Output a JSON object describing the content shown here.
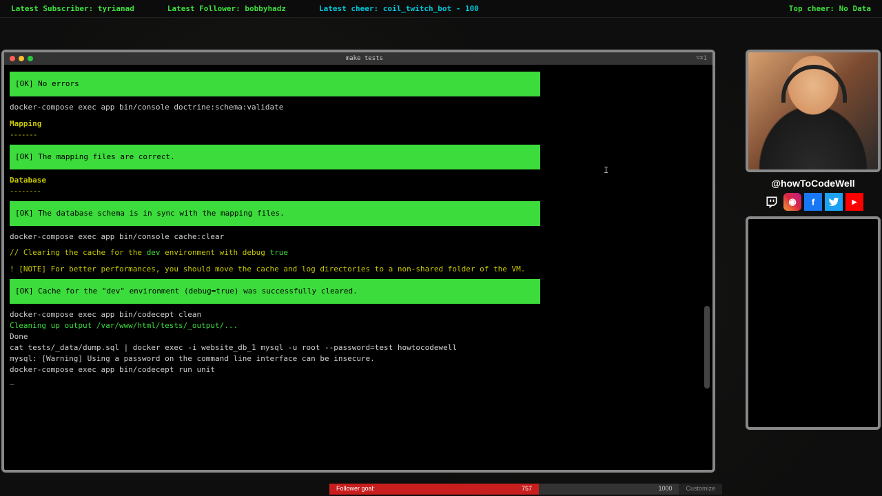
{
  "ticker": {
    "subscriber": {
      "label": "Latest Subscriber:",
      "value": "tyrianad"
    },
    "follower": {
      "label": "Latest Follower:",
      "value": "bobbyhadz"
    },
    "cheer": {
      "label": "Latest cheer:",
      "value": "coil_twitch_bot - 100"
    },
    "topcheer": {
      "label": "Top cheer:",
      "value": "No Data"
    }
  },
  "terminal": {
    "window_title": "make tests",
    "shortcut_hint": "⌥⌘1",
    "ok1": "[OK] No errors",
    "cmd1": "docker-compose exec app bin/console doctrine:schema:validate",
    "sec1": "Mapping",
    "dash": "-------",
    "ok2": "[OK] The mapping files are correct.",
    "sec2": "Database",
    "dash2": "--------",
    "ok3": "[OK] The database schema is in sync with the mapping files.",
    "cmd2": "docker-compose exec app bin/console cache:clear",
    "comment_pre": " // Clearing the cache for the ",
    "comment_dev": "dev",
    "comment_mid": " environment with debug ",
    "comment_true": "true",
    "note": " ! [NOTE] For better performances, you should move the cache and log directories to a non-shared folder of the VM.",
    "ok4": "[OK] Cache for the \"dev\" environment (debug=true) was successfully cleared.",
    "cmd3": "docker-compose exec app bin/codecept clean",
    "cleanup": "Cleaning up output /var/www/html/tests/_output/...",
    "done": "Done",
    "cat": "cat tests/_data/dump.sql | docker exec -i website_db_1 mysql -u root --password=test howtocodewell",
    "warn": "mysql: [Warning] Using a password on the command line interface can be insecure.",
    "cmd4": "docker-compose exec app bin/codecept run unit",
    "prompt": "_"
  },
  "social": {
    "handle": "@howToCodeWell",
    "twitch": "⧉",
    "instagram": "◉",
    "facebook": "f",
    "twitter": "🐦",
    "youtube": "▶"
  },
  "goal": {
    "label": "Follower goal:",
    "current": "757",
    "target": "1000",
    "customize": "Customize"
  }
}
